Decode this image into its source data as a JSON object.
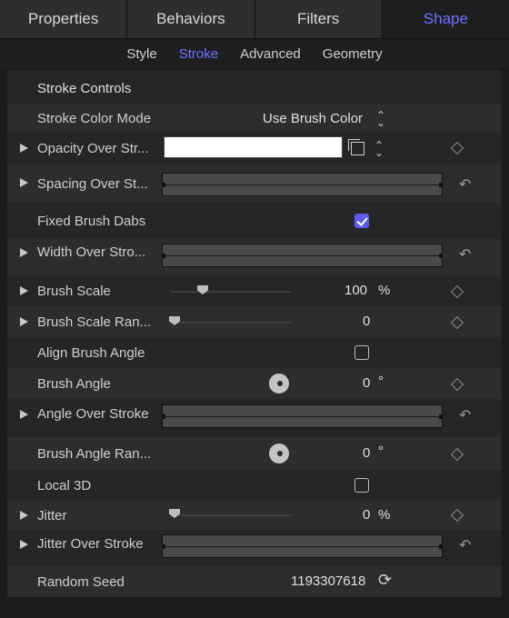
{
  "tabs": [
    "Properties",
    "Behaviors",
    "Filters",
    "Shape"
  ],
  "subtabs": [
    "Style",
    "Stroke",
    "Advanced",
    "Geometry"
  ],
  "accent_color": "#6f72ff",
  "section_title": "Stroke Controls",
  "rows": {
    "stroke_color_mode": {
      "label": "Stroke Color Mode",
      "value": "Use Brush Color"
    },
    "opacity_over_stroke": {
      "label": "Opacity Over Str...",
      "swatch_color": "#ffffff"
    },
    "spacing_over_stroke": {
      "label": "Spacing Over St..."
    },
    "fixed_brush_dabs": {
      "label": "Fixed Brush Dabs",
      "checked": true
    },
    "width_over_stroke": {
      "label": "Width Over Stro..."
    },
    "brush_scale": {
      "label": "Brush Scale",
      "value": "100",
      "unit": "%"
    },
    "brush_scale_random": {
      "label": "Brush Scale Ran...",
      "value": "0"
    },
    "align_brush_angle": {
      "label": "Align Brush Angle",
      "checked": false
    },
    "brush_angle": {
      "label": "Brush Angle",
      "value": "0",
      "unit": "°"
    },
    "angle_over_stroke": {
      "label": "Angle Over Stroke"
    },
    "brush_angle_random": {
      "label": "Brush Angle Ran...",
      "value": "0",
      "unit": "°"
    },
    "local_3d": {
      "label": "Local 3D",
      "checked": false
    },
    "jitter": {
      "label": "Jitter",
      "value": "0",
      "unit": "%"
    },
    "jitter_over_stroke": {
      "label": "Jitter Over Stroke"
    },
    "random_seed": {
      "label": "Random Seed",
      "value": "1193307618"
    }
  },
  "icons": {
    "reset": "↶",
    "refresh": "⟳",
    "updown": "⌃⌄"
  }
}
